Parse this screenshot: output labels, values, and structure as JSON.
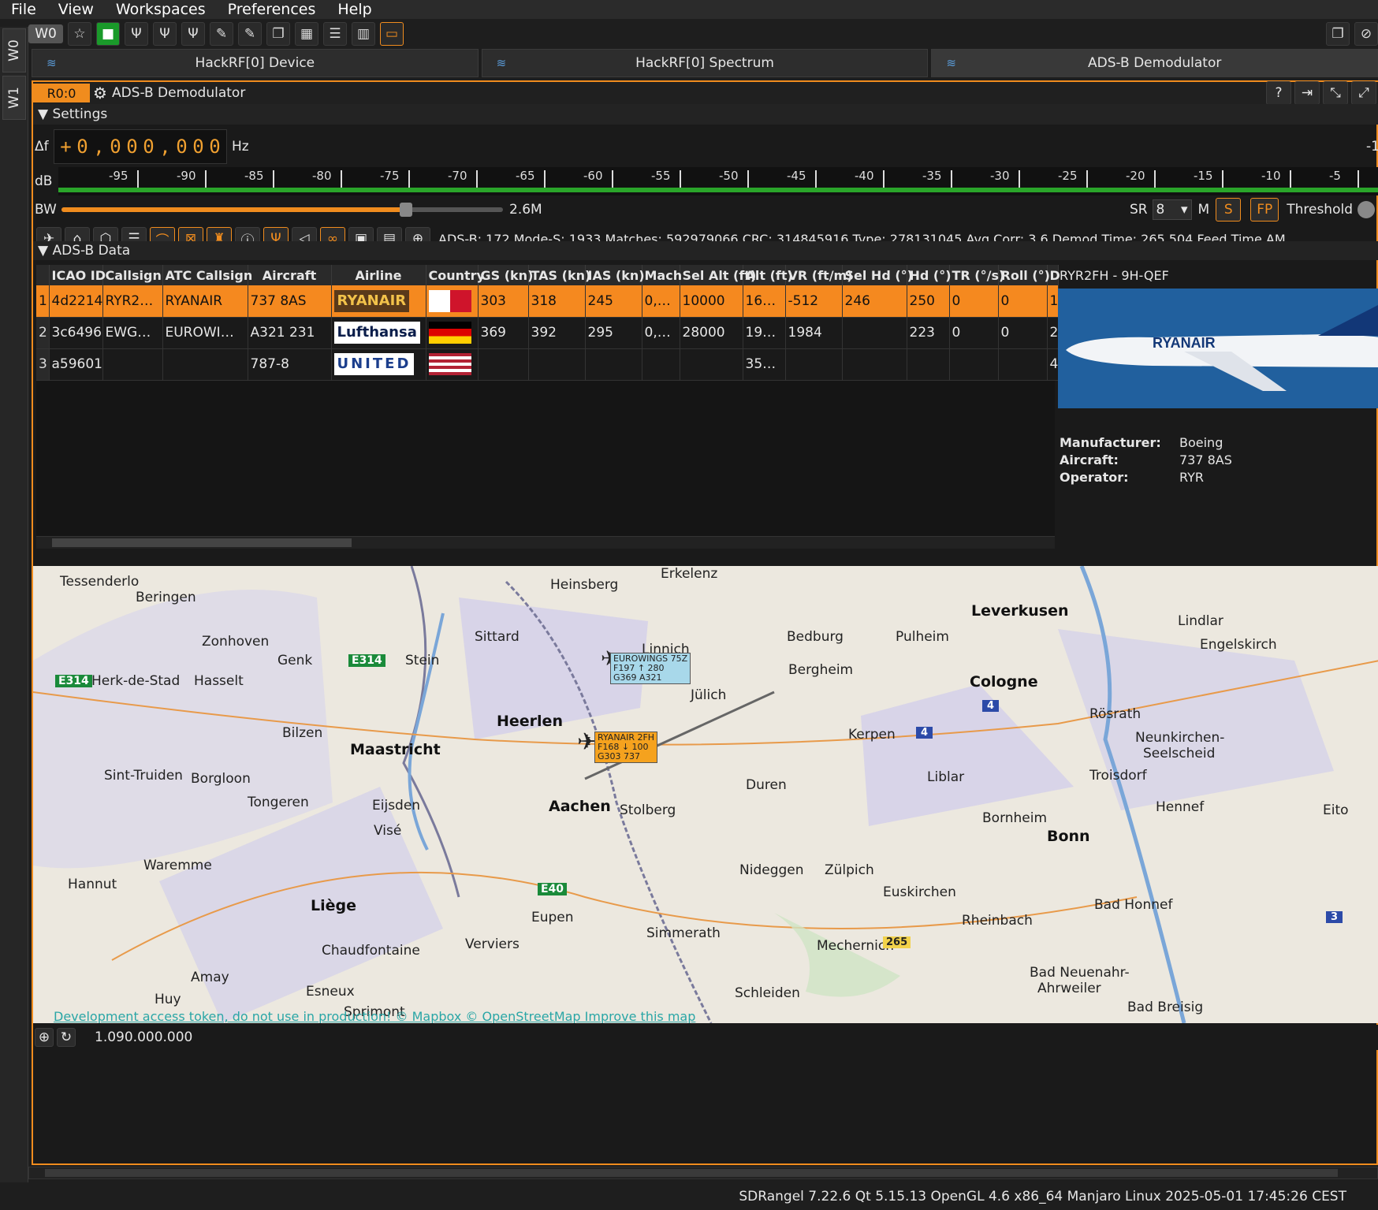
{
  "menu": [
    "File",
    "View",
    "Workspaces",
    "Preferences",
    "Help"
  ],
  "workspace_btn": "W0",
  "vtabs": [
    "W0",
    "W1"
  ],
  "device_tabs": [
    {
      "label": "HackRF[0] Device"
    },
    {
      "label": "HackRF[0] Spectrum"
    },
    {
      "label": "ADS-B Demodulator"
    }
  ],
  "channel": {
    "index": "R0:0",
    "title": "ADS-B Demodulator"
  },
  "settings_label": "Settings",
  "delta_f": {
    "label": "Δf",
    "digits": [
      "+",
      "0",
      ",",
      "0",
      "0",
      "0",
      ",",
      "0",
      "0",
      "0"
    ],
    "unit": "Hz",
    "right": "-1"
  },
  "db_scale": {
    "label": "dB",
    "ticks": [
      "-95",
      "-90",
      "-85",
      "-80",
      "-75",
      "-70",
      "-65",
      "-60",
      "-55",
      "-50",
      "-45",
      "-40",
      "-35",
      "-30",
      "-25",
      "-20",
      "-15",
      "-10",
      "-5"
    ]
  },
  "bw": {
    "label": "BW",
    "value": "2.6M",
    "level": 0.78
  },
  "sr": {
    "label": "SR",
    "value": "8",
    "m": "M",
    "s": "S",
    "fp": "FP",
    "threshold": "Threshold"
  },
  "stats": "ADS-B: 172 Mode-S: 1933 Matches: 592979066 CRC: 314845916 Type: 278131045 Avg Corr: 3.6 Demod Time: 265.504 Feed Time AM",
  "data_label": "ADS-B Data",
  "table": {
    "headers": [
      "ICAO ID",
      "Callsign",
      "ATC Callsign",
      "Aircraft",
      "Airline",
      "Country",
      "GS (kn)",
      "TAS (kn)",
      "IAS (kn)",
      "Mach",
      "Sel Alt (ft)",
      "Alt (ft)",
      "VR (ft/m)",
      "Sel Hd (°)",
      "Hd (°)",
      "TR (°/s)",
      "Roll (°)",
      "D"
    ],
    "rows": [
      {
        "n": "1",
        "icao": "4d2214",
        "callsign": "RYR2…",
        "atc": "RYANAIR",
        "aircraft": "737 8AS",
        "airline": "RYANAIR",
        "gs": "303",
        "tas": "318",
        "ias": "245",
        "mach": "0,…",
        "selalt": "10000",
        "alt": "16…",
        "vr": "-512",
        "selhd": "246",
        "hd": "250",
        "tr": "0",
        "roll": "0",
        "d": "1"
      },
      {
        "n": "2",
        "icao": "3c6496",
        "callsign": "EWG…",
        "atc": "EUROWI…",
        "aircraft": "A321 231",
        "airline": "Lufthansa",
        "gs": "369",
        "tas": "392",
        "ias": "295",
        "mach": "0,…",
        "selalt": "28000",
        "alt": "19…",
        "vr": "1984",
        "selhd": "",
        "hd": "223",
        "tr": "0",
        "roll": "0",
        "d": "2"
      },
      {
        "n": "3",
        "icao": "a59601",
        "callsign": "",
        "atc": "",
        "aircraft": "787-8",
        "airline": "UNITED",
        "gs": "",
        "tas": "",
        "ias": "",
        "mach": "",
        "selalt": "",
        "alt": "35…",
        "vr": "",
        "selhd": "",
        "hd": "",
        "tr": "",
        "roll": "",
        "d": "4"
      }
    ]
  },
  "side": {
    "title": "RYR2FH - 9H-QEF",
    "photo_text": "RYANAIR",
    "kv": [
      {
        "k": "Manufacturer:",
        "v": "Boeing"
      },
      {
        "k": "Aircraft:",
        "v": "737 8AS"
      },
      {
        "k": "Operator:",
        "v": "RYR"
      }
    ]
  },
  "map": {
    "places": [
      "Tessenderlo",
      "Beringen",
      "Heinsberg",
      "Erkelenz",
      "Leverkusen",
      "Lindlar",
      "Engelskirch",
      "Sittard",
      "Linnich",
      "Bedburg",
      "Pulheim",
      "Zonhoven",
      "Genk",
      "Stein",
      "Bergheim",
      "Cologne",
      "Herk-de-Stad",
      "Hasselt",
      "Jülich",
      "Rösrath",
      "Heerlen",
      "Kerpen",
      "Neunkirchen-",
      "Seelscheid",
      "Bilzen",
      "Maastricht",
      "Sint-Truiden",
      "Borgloon",
      "Duren",
      "Liblar",
      "Troisdorf",
      "Tongeren",
      "Eijsden",
      "Aachen",
      "Stolberg",
      "Hennef",
      "Bornheim",
      "Bonn",
      "Eito",
      "Visé",
      "Waremme",
      "Hannut",
      "Nideggen",
      "Zülpich",
      "Euskirchen",
      "Liège",
      "Bad Honnef",
      "Eupen",
      "Rheinbach",
      "Verviers",
      "Simmerath",
      "Mechernich",
      "Chaudfontaine",
      "Amay",
      "Esneux",
      "Schleiden",
      "Bad Neuenahr-",
      "Ahrweiler",
      "Huy",
      "Sprimont",
      "Bad Breisig"
    ],
    "roads": [
      "E314",
      "E314",
      "E40",
      "4",
      "4",
      "265",
      "3"
    ],
    "label_ewg": [
      "EUROWINGS 75Z",
      "F197 ↑ 280",
      "G369 A321"
    ],
    "label_ryr": [
      "RYANAIR 2FH",
      "F168 ↓ 100",
      "G303 737"
    ],
    "attribution": "Development access token, do not use in production! © Mapbox © OpenStreetMap Improve this map"
  },
  "frequency": "1.090.000.000",
  "status": "SDRangel 7.22.6 Qt 5.15.13 OpenGL 4.6 x86_64 Manjaro Linux  2025-05-01 17:45:26 CEST"
}
